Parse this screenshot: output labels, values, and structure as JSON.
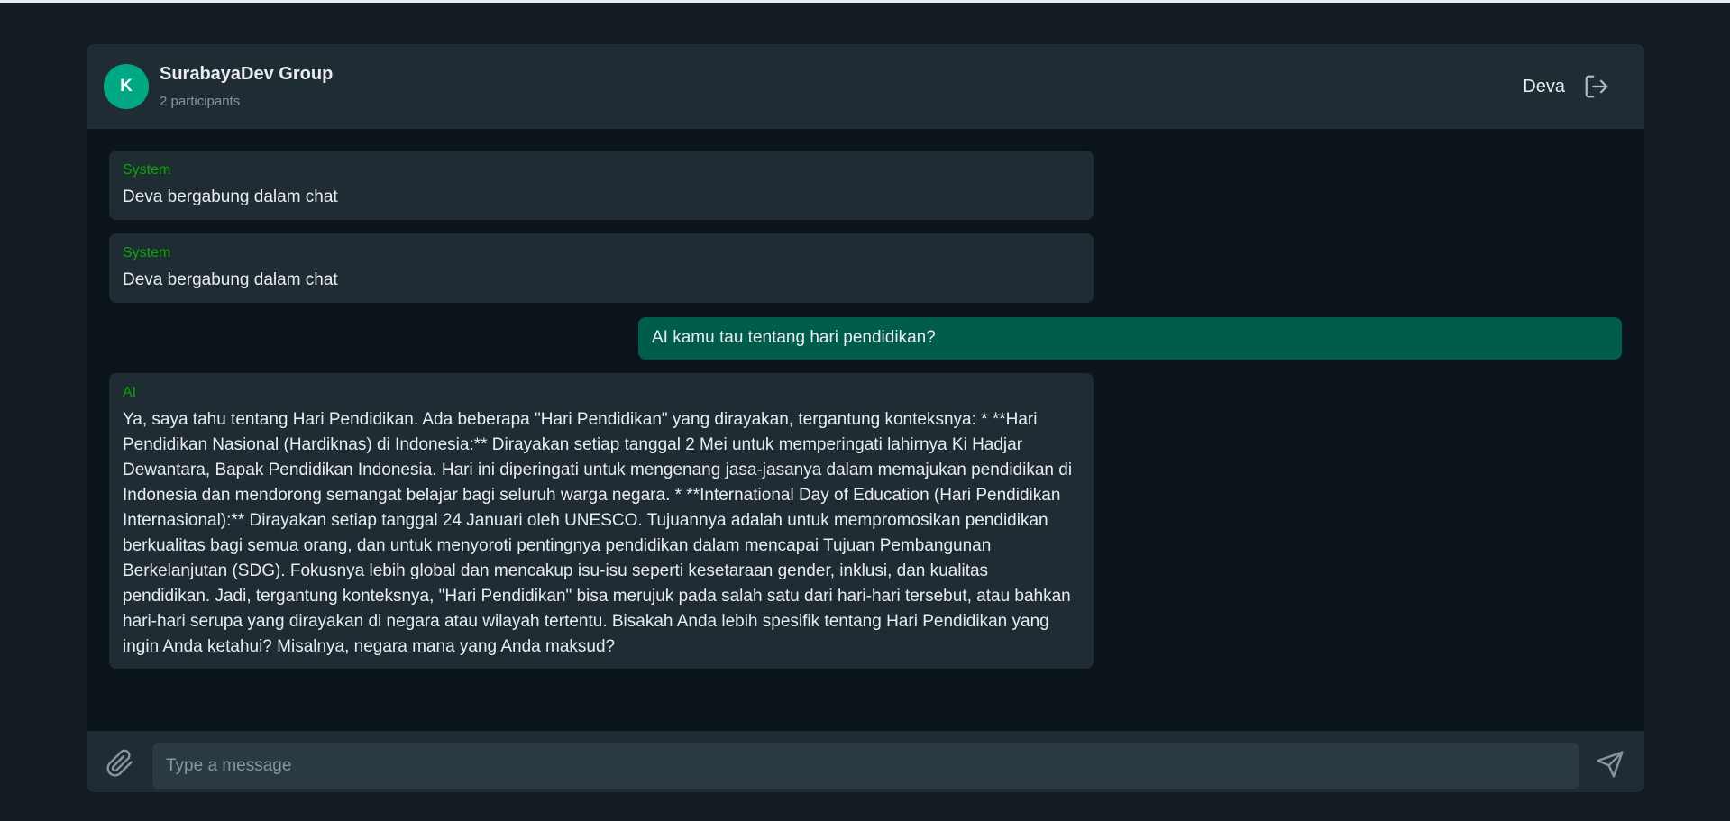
{
  "header": {
    "avatar_letter": "K",
    "title": "SurabayaDev Group",
    "subtitle": "2 participants",
    "username": "Deva",
    "logout_icon": "logout-icon"
  },
  "messages": [
    {
      "sender": "System",
      "text": "Deva bergabung dalam chat",
      "direction": "in"
    },
    {
      "sender": "System",
      "text": "Deva bergabung dalam chat",
      "direction": "in"
    },
    {
      "sender": "",
      "text": "AI kamu tau tentang hari pendidikan?",
      "direction": "out"
    },
    {
      "sender": "AI",
      "text": "Ya, saya tahu tentang Hari Pendidikan. Ada beberapa \"Hari Pendidikan\" yang dirayakan, tergantung konteksnya: * **Hari Pendidikan Nasional (Hardiknas) di Indonesia:** Dirayakan setiap tanggal 2 Mei untuk memperingati lahirnya Ki Hadjar Dewantara, Bapak Pendidikan Indonesia. Hari ini diperingati untuk mengenang jasa-jasanya dalam memajukan pendidikan di Indonesia dan mendorong semangat belajar bagi seluruh warga negara. * **International Day of Education (Hari Pendidikan Internasional):** Dirayakan setiap tanggal 24 Januari oleh UNESCO. Tujuannya adalah untuk mempromosikan pendidikan berkualitas bagi semua orang, dan untuk menyoroti pentingnya pendidikan dalam mencapai Tujuan Pembangunan Berkelanjutan (SDG). Fokusnya lebih global dan mencakup isu-isu seperti kesetaraan gender, inklusi, dan kualitas pendidikan. Jadi, tergantung konteksnya, \"Hari Pendidikan\" bisa merujuk pada salah satu dari hari-hari tersebut, atau bahkan hari-hari serupa yang dirayakan di negara atau wilayah tertentu. Bisakah Anda lebih spesifik tentang Hari Pendidikan yang ingin Anda ketahui? Misalnya, negara mana yang Anda maksud?",
      "direction": "in"
    }
  ],
  "composer": {
    "placeholder": "Type a message",
    "attach_icon": "paperclip-icon",
    "send_icon": "send-icon"
  },
  "colors": {
    "accent": "#00a884",
    "outgoing_bubble": "#005c4b",
    "incoming_bubble": "#202c33",
    "sender_label": "#08a800"
  }
}
